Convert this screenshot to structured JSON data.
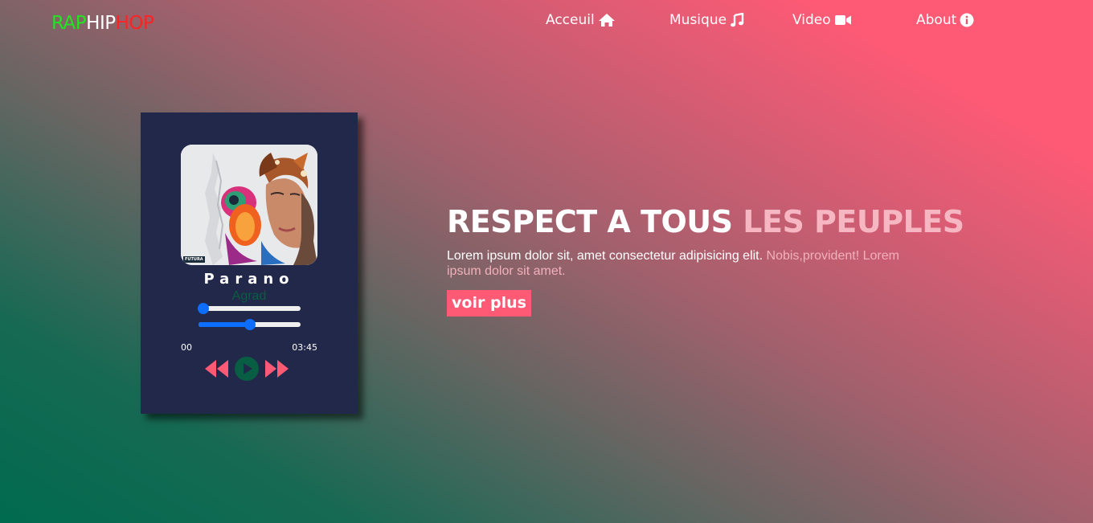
{
  "logo": {
    "part1": "RAP",
    "part2": "HIP",
    "part3": "HOP"
  },
  "nav": [
    {
      "label": "Acceuil",
      "icon": "home-icon"
    },
    {
      "label": "Musique",
      "icon": "music-icon"
    },
    {
      "label": "Video",
      "icon": "video-icon"
    },
    {
      "label": "About",
      "icon": "info-icon"
    }
  ],
  "player": {
    "cover_tag": "FUTURA",
    "title": "Parano",
    "artist": "Agrad",
    "volume_level": 0.05,
    "progress_level": 0.5,
    "time_current": "00",
    "time_total": "03:45",
    "controls": [
      "backward-icon",
      "play-icon",
      "forward-icon"
    ]
  },
  "hero": {
    "title_part1": "RESPECT A TOUS",
    "title_part2": "LES PEUPLES",
    "text_part1": "Lorem ipsum dolor sit, amet consectetur adipisicing elit.",
    "text_part2": "Nobis,provident! Lorem ipsum dolor sit amet.",
    "button_label": "voir plus"
  },
  "colors": {
    "logo_green": "#23e423",
    "logo_red": "#ff2323",
    "accent_pink": "#fe5a75",
    "player_bg": "#22284a",
    "slider_blue": "#0d6efd",
    "play_green": "#075e43"
  }
}
